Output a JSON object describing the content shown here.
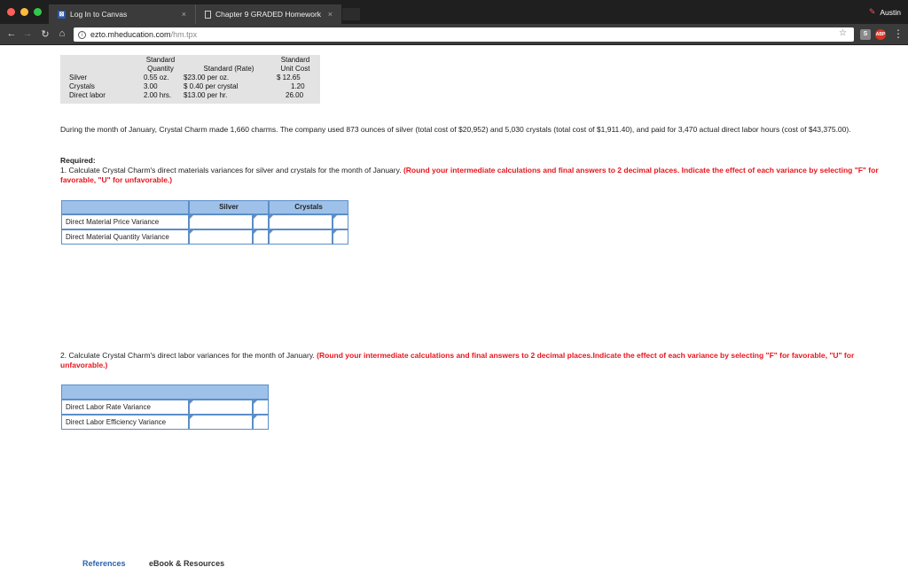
{
  "browser": {
    "tabs": [
      {
        "title": "Log In to Canvas",
        "favicon": "canvas-favicon"
      },
      {
        "title": "Chapter 9 GRADED Homework",
        "favicon": "document-favicon"
      }
    ],
    "close_glyph": "×",
    "profile_name": "Austin",
    "url_host": "ezto.mheducation.com",
    "url_path": "/hm.tpx",
    "extensions": [
      "S",
      "ABP"
    ]
  },
  "standards": {
    "headers": {
      "quantity_line1": "Standard",
      "quantity_line2": "Quantity",
      "rate": "Standard (Rate)",
      "unitcost_line1": "Standard",
      "unitcost_line2": "Unit Cost"
    },
    "rows": [
      {
        "item": "Silver",
        "quantity": "0.55 oz.",
        "rate": "$23.00 per oz.",
        "unit_cost": "$ 12.65"
      },
      {
        "item": "Crystals",
        "quantity": "3.00",
        "rate": "$  0.40 per crystal",
        "unit_cost": "1.20"
      },
      {
        "item": "Direct labor",
        "quantity": "2.00 hrs.",
        "rate": "$13.00 per hr.",
        "unit_cost": "26.00"
      }
    ]
  },
  "problem": {
    "paragraph": "During the month of January, Crystal Charm made 1,660 charms. The company used 873 ounces of silver (total cost of $20,952) and 5,030 crystals (total cost of $1,911.40), and paid for 3,470 actual direct labor hours (cost of $43,375.00).",
    "required_label": "Required:",
    "q1_text": "1. Calculate Crystal Charm's direct materials variances for silver and crystals for the month of January. ",
    "q1_note": "(Round your intermediate calculations and final answers to 2 decimal places. Indicate the effect of each variance by selecting \"F\" for favorable, \"U\" for unfavorable.)",
    "q2_text": "2. Calculate Crystal Charm's direct labor variances for the month of January. ",
    "q2_note": "(Round your intermediate calculations and final answers to 2 decimal places.Indicate the effect of each variance by selecting \"F\" for favorable, \"U\" for unfavorable.)"
  },
  "table1": {
    "col_silver": "Silver",
    "col_crystals": "Crystals",
    "rows": [
      "Direct Material Price Variance",
      "Direct Material Quantity Variance"
    ]
  },
  "table2": {
    "rows": [
      "Direct Labor Rate Variance",
      "Direct Labor Efficiency Variance"
    ]
  },
  "bottom_tabs": {
    "references": "References",
    "ebook": "eBook & Resources"
  }
}
